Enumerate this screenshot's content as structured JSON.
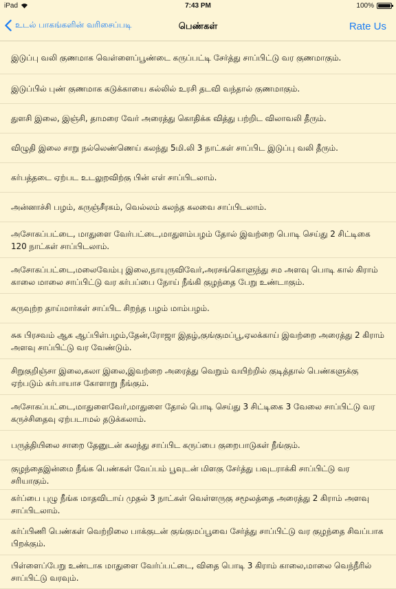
{
  "status_bar": {
    "carrier": "iPad",
    "time": "7:43 PM",
    "battery": "100%"
  },
  "nav": {
    "back_label": "உடல் பாகங்களின் வரிசைப்படி",
    "title": "பெண்கள்",
    "rate_label": "Rate Us"
  },
  "items": [
    {
      "text": "இடுப்பு வலி குணமாக வெள்ளைப்பூண்டை கருப்பட்டி சேர்த்து சாப்பிட்டு வர குணமாகும்."
    },
    {
      "text": "இடுப்பில் புண் குணமாக கடுக்காயை கல்லில் உரசி தடவி வந்தால் குணமாகும்."
    },
    {
      "text": "துளசி இலை, இஞ்சி, தாமரை வேர் அரைத்து கொதிக்க வித்து பற்றிட விலாவலி தீரும்."
    },
    {
      "text": "விழுதி இலை சாறு நல்லெண்ணெய் கலந்து 5மி.லி 3 நாட்கள் சாப்பிட இடுப்பு வலி தீரும்."
    },
    {
      "text": "கர்பத்தடை ஏற்பட உடலுறவிற்கு பின் எள் சாப்பிடலாம்."
    },
    {
      "text": "அன்னாச்சி பழம், கருஞ்சீரகம், வெல்லம் கலந்த கலவை சாப்பிடலாம்."
    },
    {
      "text": "அசோகப்பட்டை, மாதுளை வேர்பட்டை,மாதுளம்பழம் தோல் இவற்றை பொடி செய்து 2 சிட்டிகை 120 நாட்கள் சாப்பிடலாம்."
    },
    {
      "text": "அசோகப்பட்டை,மலைவேம்பு இலை,நாயுருவிவேர்,அரசங்கொளுந்து சம அளவு பொடி கால் கிராம் காலை மாலை சாப்பிட்டு வர கர்பப்பை நோய் நீங்கி குழந்தை பேறு உண்டாகும்."
    },
    {
      "text": "கருவுற்ற தாய்மார்கள் சாப்பிட சிறந்த பழம் மாம்பழம்."
    },
    {
      "text": "சுக பிரசவம் ஆக ஆப்பிள்பழம்,தேன்,ரோஜா இதழ்,குங்குமப்பூ,ஏலக்காய் இவற்றை அரைத்து 2 கிராம் அளவு சாப்பிட்டு வர வேண்டும்."
    },
    {
      "text": "சிறுகுறிஞ்சா இலை,கலா இலை,இவற்றை அரைத்து வெறும் வயிற்றில் குடித்தால் பெண்களுக்கு ஏற்படும் கர்பாயாச கோளாறு நீங்கும்."
    },
    {
      "text": "அசோகப்பட்டை,மாதுளைவேர்,மாதுளை தோல் பொடி செய்து 3 சிட்டிகை 3 வேலை சாப்பிட்டு வர கருச்சிதைவு ஏற்படாமல் தடுக்கலாம்."
    },
    {
      "text": "பருத்தியிலை சாறை தேனுடன் கலந்து சாப்பிட கருப்பை குறைபாடுகள் நீங்கும்."
    },
    {
      "text": "குழந்தைஇன்மை நீங்க பெண்கள் வேப்பம் பூவுடன் மிளகு சேர்த்து பவுடராக்கி சாப்பிட்டு வர சரியாகும்."
    },
    {
      "text": "கர்ப்பை புழு நீங்க மாதவிடாய் முதல் 3 நாட்கள் வெள்ளருகு சமூலத்தை அரைத்து 2 கிராம் அளவு சாப்பிடலாம்."
    },
    {
      "text": "கர்ப்பிணி பெண்கள் வெற்றிலை பாக்குடன் குங்குமப்பூவை சேர்த்து சாப்பிட்டு வர குழந்தை சிவப்பாக பிறக்கும்."
    },
    {
      "text": "பிள்ளைப்பேறு உண்டாக மாதுளை வேர்ப்பட்டை, விதை பொடி 3 கிராம் காலை,மாலை வெந்நீரில் சாப்பிட்டு வரவும்."
    }
  ]
}
